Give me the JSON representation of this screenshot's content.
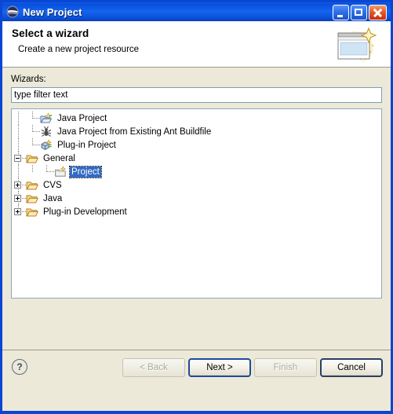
{
  "window": {
    "title": "New Project",
    "icon": "eclipse-globe-icon",
    "controls": {
      "minimize": "minimize-button",
      "maximize": "maximize-button",
      "close": "close-button"
    },
    "colors": {
      "titlebar_blue": "#0b55e2",
      "frame_blue": "#0a46d2",
      "body_beige": "#ece9d8",
      "selection_blue": "#316ac5",
      "close_red": "#c42f10"
    }
  },
  "header": {
    "title": "Select a wizard",
    "subtitle": "Create a new project resource",
    "banner_icon": "new-project-wizard-icon"
  },
  "form": {
    "wizards_label": "Wizards:",
    "filter": {
      "value": "",
      "placeholder": "type filter text"
    }
  },
  "tree": {
    "items": [
      {
        "label": "Java Project",
        "level": 1,
        "expander": "none",
        "icon": "java-project-icon",
        "selected": false
      },
      {
        "label": "Java Project from Existing Ant Buildfile",
        "level": 1,
        "expander": "none",
        "icon": "ant-buildfile-icon",
        "selected": false
      },
      {
        "label": "Plug-in Project",
        "level": 1,
        "expander": "none",
        "icon": "plugin-project-icon",
        "selected": false
      },
      {
        "label": "General",
        "level": 0,
        "expander": "minus",
        "icon": "folder-open-icon",
        "selected": false
      },
      {
        "label": "Project",
        "level": 2,
        "expander": "none",
        "icon": "project-icon",
        "selected": true
      },
      {
        "label": "CVS",
        "level": 0,
        "expander": "plus",
        "icon": "folder-open-icon",
        "selected": false
      },
      {
        "label": "Java",
        "level": 0,
        "expander": "plus",
        "icon": "folder-open-icon",
        "selected": false
      },
      {
        "label": "Plug-in Development",
        "level": 0,
        "expander": "plus",
        "icon": "folder-open-icon",
        "selected": false
      }
    ]
  },
  "footer": {
    "help_label": "?",
    "buttons": [
      {
        "label": "< Back",
        "state": "disabled"
      },
      {
        "label": "Next >",
        "state": "default"
      },
      {
        "label": "Finish",
        "state": "disabled"
      },
      {
        "label": "Cancel",
        "state": "enabled"
      }
    ]
  }
}
